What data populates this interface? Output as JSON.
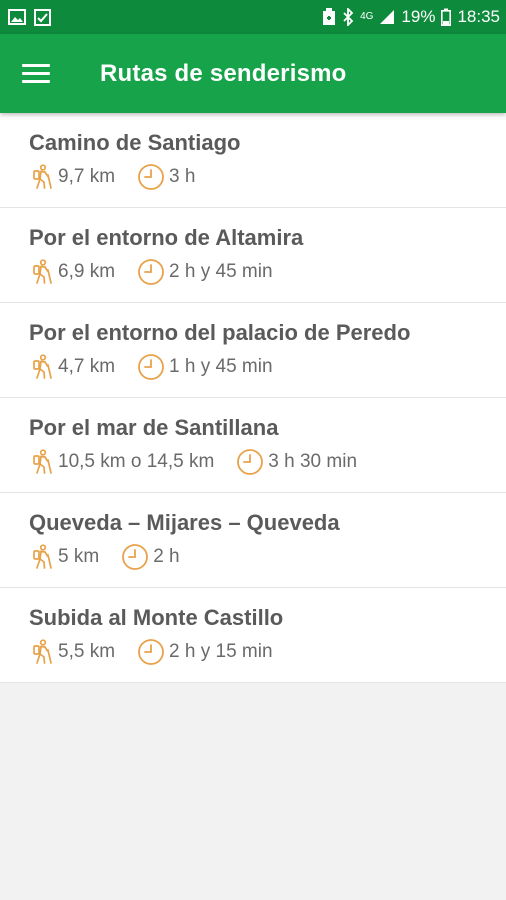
{
  "status_bar": {
    "battery": "19%",
    "time": "18:35",
    "network": "4G",
    "icons": [
      "image-icon",
      "checkbox-icon",
      "battery-saver-icon",
      "bluetooth-icon",
      "signal-icon",
      "battery-icon"
    ]
  },
  "app_bar": {
    "title": "Rutas de senderismo",
    "menu_icon": "hamburger-menu-icon",
    "background": "#16a34a"
  },
  "colors": {
    "accent_icon": "#e8a24a",
    "status_bar": "#0e8a3c"
  },
  "routes": [
    {
      "title": "Camino de Santiago",
      "distance": "9,7 km",
      "duration": "3 h"
    },
    {
      "title": "Por el entorno de Altamira",
      "distance": "6,9 km",
      "duration": "2 h y 45 min"
    },
    {
      "title": "Por el entorno del palacio de Peredo",
      "distance": "4,7 km",
      "duration": "1 h y 45 min"
    },
    {
      "title": "Por el mar de Santillana",
      "distance": "10,5 km o 14,5 km",
      "duration": "3 h 30 min"
    },
    {
      "title": "Queveda – Mijares – Queveda",
      "distance": "5 km",
      "duration": "2 h"
    },
    {
      "title": "Subida al Monte Castillo",
      "distance": "5,5 km",
      "duration": "2 h y 15 min"
    }
  ]
}
